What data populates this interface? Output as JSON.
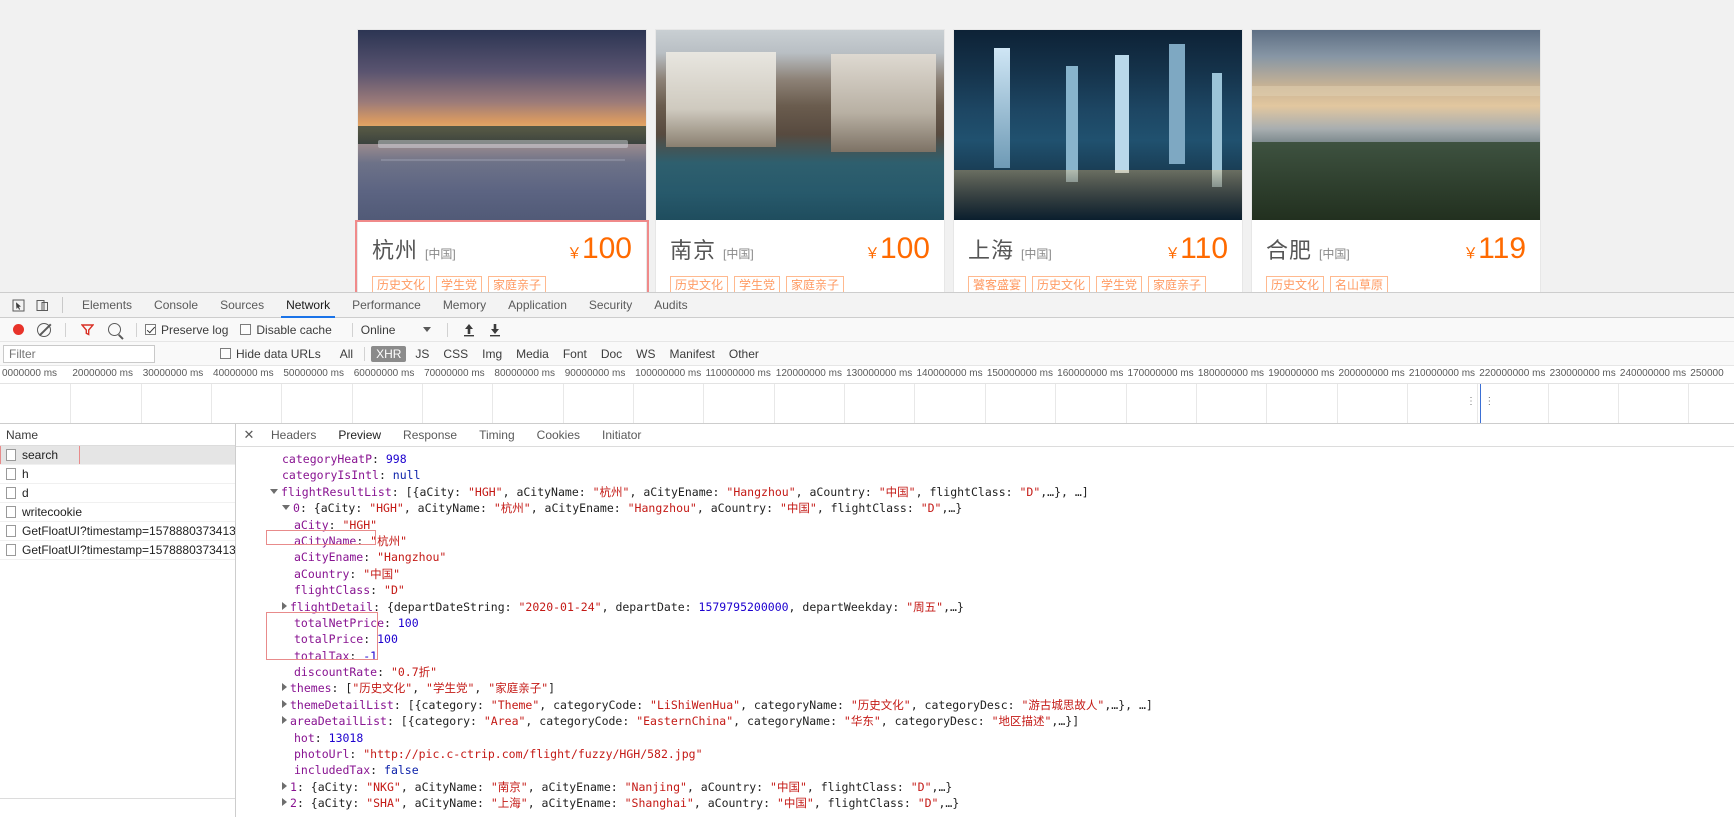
{
  "page": {
    "cards": [
      {
        "city": "杭州",
        "country": "[中国]",
        "currency": "￥",
        "price": "100",
        "tags": [
          "历史文化",
          "学生党",
          "家庭亲子"
        ],
        "photo": "hangzhou-west-lake-sunset",
        "selected": true
      },
      {
        "city": "南京",
        "country": "[中国]",
        "currency": "￥",
        "price": "100",
        "tags": [
          "历史文化",
          "学生党",
          "家庭亲子"
        ],
        "photo": "nanjing-water-town",
        "selected": false
      },
      {
        "city": "上海",
        "country": "[中国]",
        "currency": "￥",
        "price": "110",
        "tags": [
          "饕客盛宴",
          "历史文化",
          "学生党",
          "家庭亲子"
        ],
        "photo": "shanghai-skyline-night",
        "selected": false
      },
      {
        "city": "合肥",
        "country": "[中国]",
        "currency": "￥",
        "price": "119",
        "tags": [
          "历史文化",
          "名山草原"
        ],
        "photo": "hefei-lake-dusk",
        "selected": false
      }
    ]
  },
  "devtools": {
    "panels": [
      "Elements",
      "Console",
      "Sources",
      "Network",
      "Performance",
      "Memory",
      "Application",
      "Security",
      "Audits"
    ],
    "active_panel": "Network",
    "icons": {
      "inspect": "inspect-element-icon",
      "device": "device-toolbar-icon"
    },
    "toolbar": {
      "record_label": "record-button",
      "clear_label": "clear-button",
      "filter_label": "filter-button",
      "search_label": "search-button",
      "preserve_log": "Preserve log",
      "preserve_log_checked": true,
      "disable_cache": "Disable cache",
      "disable_cache_checked": false,
      "throttling": "Online",
      "import_label": "import-har-button",
      "export_label": "export-har-button"
    },
    "filterbar": {
      "filter_placeholder": "Filter",
      "filter_value": "",
      "hide_data_urls": "Hide data URLs",
      "hide_data_urls_checked": false,
      "types": [
        "All",
        "XHR",
        "JS",
        "CSS",
        "Img",
        "Media",
        "Font",
        "Doc",
        "WS",
        "Manifest",
        "Other"
      ],
      "active_type": "XHR"
    },
    "overview": {
      "ticks": [
        "0000000 ms",
        "20000000 ms",
        "30000000 ms",
        "40000000 ms",
        "50000000 ms",
        "60000000 ms",
        "70000000 ms",
        "80000000 ms",
        "90000000 ms",
        "100000000 ms",
        "110000000 ms",
        "120000000 ms",
        "130000000 ms",
        "140000000 ms",
        "150000000 ms",
        "160000000 ms",
        "170000000 ms",
        "180000000 ms",
        "190000000 ms",
        "200000000 ms",
        "210000000 ms",
        "220000000 ms",
        "230000000 ms",
        "240000000 ms",
        "250000"
      ]
    },
    "requests": {
      "header": "Name",
      "rows": [
        {
          "name": "search",
          "selected": true
        },
        {
          "name": "h",
          "selected": false
        },
        {
          "name": "d",
          "selected": false
        },
        {
          "name": "writecookie",
          "selected": false
        },
        {
          "name": "GetFloatUI?timestamp=1578880373413",
          "selected": false
        },
        {
          "name": "GetFloatUI?timestamp=1578880373413",
          "selected": false
        }
      ]
    },
    "detail": {
      "close_label": "✕",
      "tabs": [
        "Headers",
        "Preview",
        "Response",
        "Timing",
        "Cookies",
        "Initiator"
      ],
      "active_tab": "Preview"
    },
    "preview_lines": [
      {
        "indent": 1,
        "tri": "none",
        "parts": [
          {
            "t": "categoryHeatP",
            "c": "k"
          },
          {
            "t": ": ",
            "c": "p"
          },
          {
            "t": "998",
            "c": "n"
          }
        ],
        "clipped": true
      },
      {
        "indent": 1,
        "tri": "none",
        "parts": [
          {
            "t": "categoryIsIntl",
            "c": "k"
          },
          {
            "t": ": ",
            "c": "p"
          },
          {
            "t": "null",
            "c": "b"
          }
        ]
      },
      {
        "indent": 0,
        "tri": "open",
        "parts": [
          {
            "t": "flightResultList",
            "c": "k"
          },
          {
            "t": ": [{",
            "c": "p"
          },
          {
            "t": "aCity",
            "c": "p"
          },
          {
            "t": ": ",
            "c": "p"
          },
          {
            "t": "\"HGH\"",
            "c": "s"
          },
          {
            "t": ", aCityName: ",
            "c": "p"
          },
          {
            "t": "\"杭州\"",
            "c": "s"
          },
          {
            "t": ", aCityEname: ",
            "c": "p"
          },
          {
            "t": "\"Hangzhou\"",
            "c": "s"
          },
          {
            "t": ", aCountry: ",
            "c": "p"
          },
          {
            "t": "\"中国\"",
            "c": "s"
          },
          {
            "t": ", flightClass: ",
            "c": "p"
          },
          {
            "t": "\"D\"",
            "c": "s"
          },
          {
            "t": ",…}, …]",
            "c": "p"
          }
        ]
      },
      {
        "indent": 1,
        "tri": "open",
        "parts": [
          {
            "t": "0",
            "c": "k"
          },
          {
            "t": ": {aCity: ",
            "c": "p"
          },
          {
            "t": "\"HGH\"",
            "c": "s"
          },
          {
            "t": ", aCityName: ",
            "c": "p"
          },
          {
            "t": "\"杭州\"",
            "c": "s"
          },
          {
            "t": ", aCityEname: ",
            "c": "p"
          },
          {
            "t": "\"Hangzhou\"",
            "c": "s"
          },
          {
            "t": ", aCountry: ",
            "c": "p"
          },
          {
            "t": "\"中国\"",
            "c": "s"
          },
          {
            "t": ", flightClass: ",
            "c": "p"
          },
          {
            "t": "\"D\"",
            "c": "s"
          },
          {
            "t": ",…}",
            "c": "p"
          }
        ]
      },
      {
        "indent": 2,
        "tri": "none",
        "parts": [
          {
            "t": "aCity",
            "c": "k"
          },
          {
            "t": ": ",
            "c": "p"
          },
          {
            "t": "\"HGH\"",
            "c": "s"
          }
        ]
      },
      {
        "indent": 2,
        "tri": "none",
        "parts": [
          {
            "t": "aCityName",
            "c": "k"
          },
          {
            "t": ": ",
            "c": "p"
          },
          {
            "t": "\"杭州\"",
            "c": "s"
          }
        ],
        "highlight": "acityname"
      },
      {
        "indent": 2,
        "tri": "none",
        "parts": [
          {
            "t": "aCityEname",
            "c": "k"
          },
          {
            "t": ": ",
            "c": "p"
          },
          {
            "t": "\"Hangzhou\"",
            "c": "s"
          }
        ]
      },
      {
        "indent": 2,
        "tri": "none",
        "parts": [
          {
            "t": "aCountry",
            "c": "k"
          },
          {
            "t": ": ",
            "c": "p"
          },
          {
            "t": "\"中国\"",
            "c": "s"
          }
        ]
      },
      {
        "indent": 2,
        "tri": "none",
        "parts": [
          {
            "t": "flightClass",
            "c": "k"
          },
          {
            "t": ": ",
            "c": "p"
          },
          {
            "t": "\"D\"",
            "c": "s"
          }
        ]
      },
      {
        "indent": 1,
        "tri": "closed",
        "parts": [
          {
            "t": "flightDetail",
            "c": "k"
          },
          {
            "t": ": {departDateString: ",
            "c": "p"
          },
          {
            "t": "\"2020-01-24\"",
            "c": "s"
          },
          {
            "t": ", departDate: ",
            "c": "p"
          },
          {
            "t": "1579795200000",
            "c": "n"
          },
          {
            "t": ", departWeekday: ",
            "c": "p"
          },
          {
            "t": "\"周五\"",
            "c": "s"
          },
          {
            "t": ",…}",
            "c": "p"
          }
        ]
      },
      {
        "indent": 2,
        "tri": "none",
        "parts": [
          {
            "t": "totalNetPrice",
            "c": "k"
          },
          {
            "t": ": ",
            "c": "p"
          },
          {
            "t": "100",
            "c": "n"
          }
        ]
      },
      {
        "indent": 2,
        "tri": "none",
        "parts": [
          {
            "t": "totalPrice",
            "c": "k"
          },
          {
            "t": ": ",
            "c": "p"
          },
          {
            "t": "100",
            "c": "n"
          }
        ]
      },
      {
        "indent": 2,
        "tri": "none",
        "parts": [
          {
            "t": "totalTax",
            "c": "k"
          },
          {
            "t": ": ",
            "c": "p"
          },
          {
            "t": "-1",
            "c": "n"
          }
        ]
      },
      {
        "indent": 2,
        "tri": "none",
        "parts": [
          {
            "t": "discountRate",
            "c": "k"
          },
          {
            "t": ": ",
            "c": "p"
          },
          {
            "t": "\"0.7折\"",
            "c": "s"
          }
        ]
      },
      {
        "indent": 1,
        "tri": "closed",
        "parts": [
          {
            "t": "themes",
            "c": "k"
          },
          {
            "t": ": [",
            "c": "p"
          },
          {
            "t": "\"历史文化\"",
            "c": "s"
          },
          {
            "t": ", ",
            "c": "p"
          },
          {
            "t": "\"学生党\"",
            "c": "s"
          },
          {
            "t": ", ",
            "c": "p"
          },
          {
            "t": "\"家庭亲子\"",
            "c": "s"
          },
          {
            "t": "]",
            "c": "p"
          }
        ]
      },
      {
        "indent": 1,
        "tri": "closed",
        "parts": [
          {
            "t": "themeDetailList",
            "c": "k"
          },
          {
            "t": ": [{category: ",
            "c": "p"
          },
          {
            "t": "\"Theme\"",
            "c": "s"
          },
          {
            "t": ", categoryCode: ",
            "c": "p"
          },
          {
            "t": "\"LiShiWenHua\"",
            "c": "s"
          },
          {
            "t": ", categoryName: ",
            "c": "p"
          },
          {
            "t": "\"历史文化\"",
            "c": "s"
          },
          {
            "t": ", categoryDesc: ",
            "c": "p"
          },
          {
            "t": "\"游古城思故人\"",
            "c": "s"
          },
          {
            "t": ",…}, …]",
            "c": "p"
          }
        ]
      },
      {
        "indent": 1,
        "tri": "closed",
        "parts": [
          {
            "t": "areaDetailList",
            "c": "k"
          },
          {
            "t": ": [{category: ",
            "c": "p"
          },
          {
            "t": "\"Area\"",
            "c": "s"
          },
          {
            "t": ", categoryCode: ",
            "c": "p"
          },
          {
            "t": "\"EasternChina\"",
            "c": "s"
          },
          {
            "t": ", categoryName: ",
            "c": "p"
          },
          {
            "t": "\"华东\"",
            "c": "s"
          },
          {
            "t": ", categoryDesc: ",
            "c": "p"
          },
          {
            "t": "\"地区描述\"",
            "c": "s"
          },
          {
            "t": ",…}]",
            "c": "p"
          }
        ]
      },
      {
        "indent": 2,
        "tri": "none",
        "parts": [
          {
            "t": "hot",
            "c": "k"
          },
          {
            "t": ": ",
            "c": "p"
          },
          {
            "t": "13018",
            "c": "n"
          }
        ]
      },
      {
        "indent": 2,
        "tri": "none",
        "parts": [
          {
            "t": "photoUrl",
            "c": "k"
          },
          {
            "t": ": ",
            "c": "p"
          },
          {
            "t": "\"http://pic.c-ctrip.com/flight/fuzzy/HGH/582.jpg\"",
            "c": "s"
          }
        ]
      },
      {
        "indent": 2,
        "tri": "none",
        "parts": [
          {
            "t": "includedTax",
            "c": "k"
          },
          {
            "t": ": ",
            "c": "p"
          },
          {
            "t": "false",
            "c": "b"
          }
        ]
      },
      {
        "indent": 1,
        "tri": "closed",
        "parts": [
          {
            "t": "1",
            "c": "k"
          },
          {
            "t": ": {aCity: ",
            "c": "p"
          },
          {
            "t": "\"NKG\"",
            "c": "s"
          },
          {
            "t": ", aCityName: ",
            "c": "p"
          },
          {
            "t": "\"南京\"",
            "c": "s"
          },
          {
            "t": ", aCityEname: ",
            "c": "p"
          },
          {
            "t": "\"Nanjing\"",
            "c": "s"
          },
          {
            "t": ", aCountry: ",
            "c": "p"
          },
          {
            "t": "\"中国\"",
            "c": "s"
          },
          {
            "t": ", flightClass: ",
            "c": "p"
          },
          {
            "t": "\"D\"",
            "c": "s"
          },
          {
            "t": ",…}",
            "c": "p"
          }
        ]
      },
      {
        "indent": 1,
        "tri": "closed",
        "parts": [
          {
            "t": "2",
            "c": "k"
          },
          {
            "t": ": {aCity: ",
            "c": "p"
          },
          {
            "t": "\"SHA\"",
            "c": "s"
          },
          {
            "t": ", aCityName: ",
            "c": "p"
          },
          {
            "t": "\"上海\"",
            "c": "s"
          },
          {
            "t": ", aCityEname: ",
            "c": "p"
          },
          {
            "t": "\"Shanghai\"",
            "c": "s"
          },
          {
            "t": ", aCountry: ",
            "c": "p"
          },
          {
            "t": "\"中国\"",
            "c": "s"
          },
          {
            "t": ", flightClass: ",
            "c": "p"
          },
          {
            "t": "\"D\"",
            "c": "s"
          },
          {
            "t": ",…}",
            "c": "p"
          }
        ]
      }
    ],
    "colors": {
      "accent_blue": "#1a73e8",
      "record_red": "#e8332a",
      "highlight_red": "#e88b8b",
      "price_orange": "#ff6a00",
      "tag_orange": "#ff9a62",
      "json_key": "#881391",
      "json_string": "#c41a16",
      "json_number": "#1c00cf"
    }
  }
}
